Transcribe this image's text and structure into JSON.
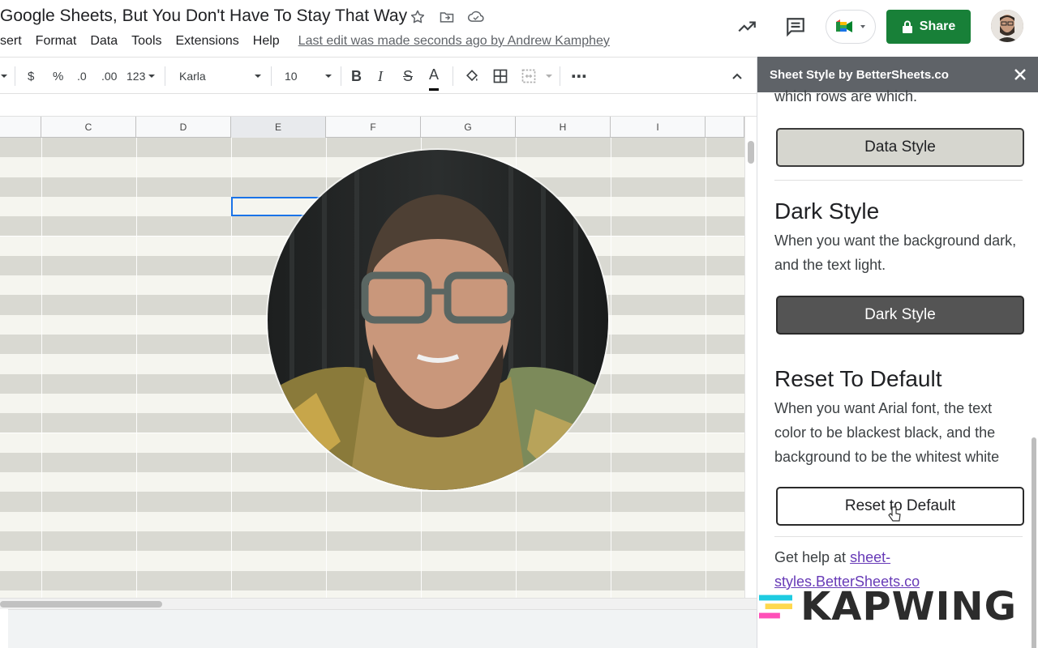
{
  "doc": {
    "title": "Google Sheets, But You Don't Have To Stay That Way",
    "menu": [
      "sert",
      "Format",
      "Data",
      "Tools",
      "Extensions",
      "Help"
    ],
    "last_edit": "Last edit was made seconds ago by Andrew Kamphey"
  },
  "header": {
    "share_label": "Share"
  },
  "toolbar": {
    "currency": "$",
    "percent": "%",
    "dec_decrease": ".0",
    "dec_increase": ".00",
    "format_more": "123",
    "font": "Karla",
    "size": "10",
    "bold": "B",
    "italic": "I",
    "strike": "S",
    "text_color": "A",
    "more": "⋯"
  },
  "grid": {
    "columns": [
      "C",
      "D",
      "E",
      "F",
      "G",
      "H",
      "I"
    ],
    "selected_column": "E"
  },
  "sidebar": {
    "title": "Sheet Style by BetterSheets.co",
    "intro_tail": "which rows are which.",
    "data_button": "Data Style",
    "dark_heading": "Dark Style",
    "dark_desc": "When you want the background dark, and the text light.",
    "dark_button": "Dark Style",
    "reset_heading": "Reset To Default",
    "reset_desc": "When you want Arial font, the text color to be blackest black, and the background to be the whitest white",
    "reset_button": "Reset to Default",
    "help_prefix": "Get help at ",
    "help_link": "sheet-styles.BetterSheets.co"
  },
  "watermark": {
    "text": "KAPWING"
  },
  "colors": {
    "share_green": "#188038",
    "row_band_dark": "#d9d9d2",
    "row_band_light": "#f5f5ef",
    "sidebar_header": "#5f6368",
    "selection_blue": "#1a73e8"
  }
}
